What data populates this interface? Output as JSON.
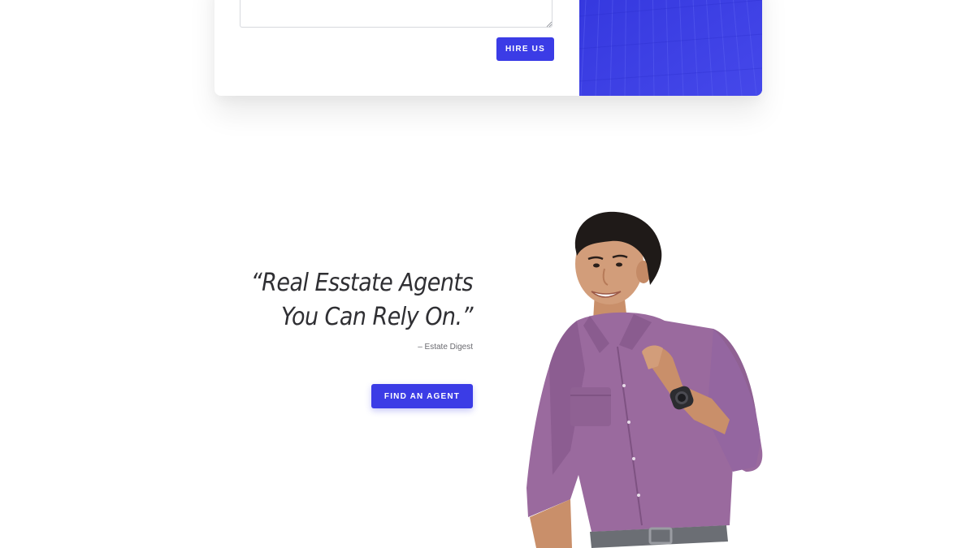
{
  "contact_form": {
    "message": {
      "value": "",
      "placeholder": ""
    },
    "hire_button_label": "HIRE US"
  },
  "testimonial": {
    "quote_line1": "“Real Esstate Agents",
    "quote_line2": "You Can Rely On.”",
    "source": "– Estate Digest",
    "cta_label": "FIND AN AGENT"
  },
  "colors": {
    "accent": "#3b3ce6",
    "panel_blue": "#3c3fe4",
    "heading_text": "#2f2f33",
    "muted_text": "#6b6b70",
    "background": "#ffffff"
  },
  "images": {
    "building_panel": "building-facade-image",
    "agent_photo": "smiling-man-purple-shirt-photo"
  }
}
